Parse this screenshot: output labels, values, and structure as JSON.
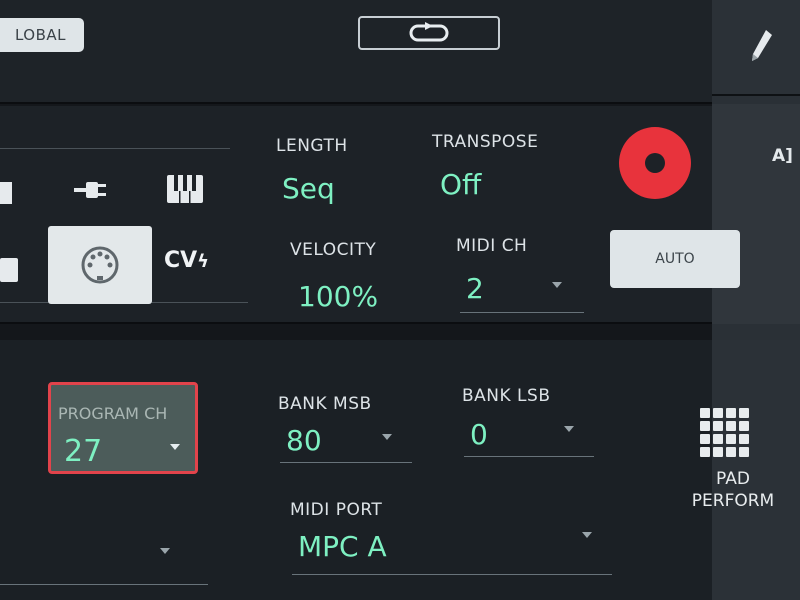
{
  "top": {
    "global_label": "LOBAL"
  },
  "sidebar": {
    "track_label": "A]"
  },
  "midi_settings": {
    "length": {
      "label": "LENGTH",
      "value": "Seq"
    },
    "transpose": {
      "label": "TRANSPOSE",
      "value": "Off"
    },
    "velocity": {
      "label": "VELOCITY",
      "value": "100%"
    },
    "midi_ch": {
      "label": "MIDI CH",
      "value": "2"
    },
    "cv_label": "CV",
    "auto_label": "AUTO"
  },
  "program": {
    "program_ch": {
      "label": "PROGRAM CH",
      "value": "27"
    },
    "bank_msb": {
      "label": "BANK MSB",
      "value": "80"
    },
    "bank_lsb": {
      "label": "BANK LSB",
      "value": "0"
    },
    "midi_port": {
      "label": "MIDI PORT",
      "value": "MPC A"
    },
    "pad_perform": {
      "line1": "PAD",
      "line2": "PERFORM"
    }
  },
  "colors": {
    "accent_value": "#7ef0c2",
    "record": "#e8333c",
    "selection_border": "#e2434b"
  }
}
